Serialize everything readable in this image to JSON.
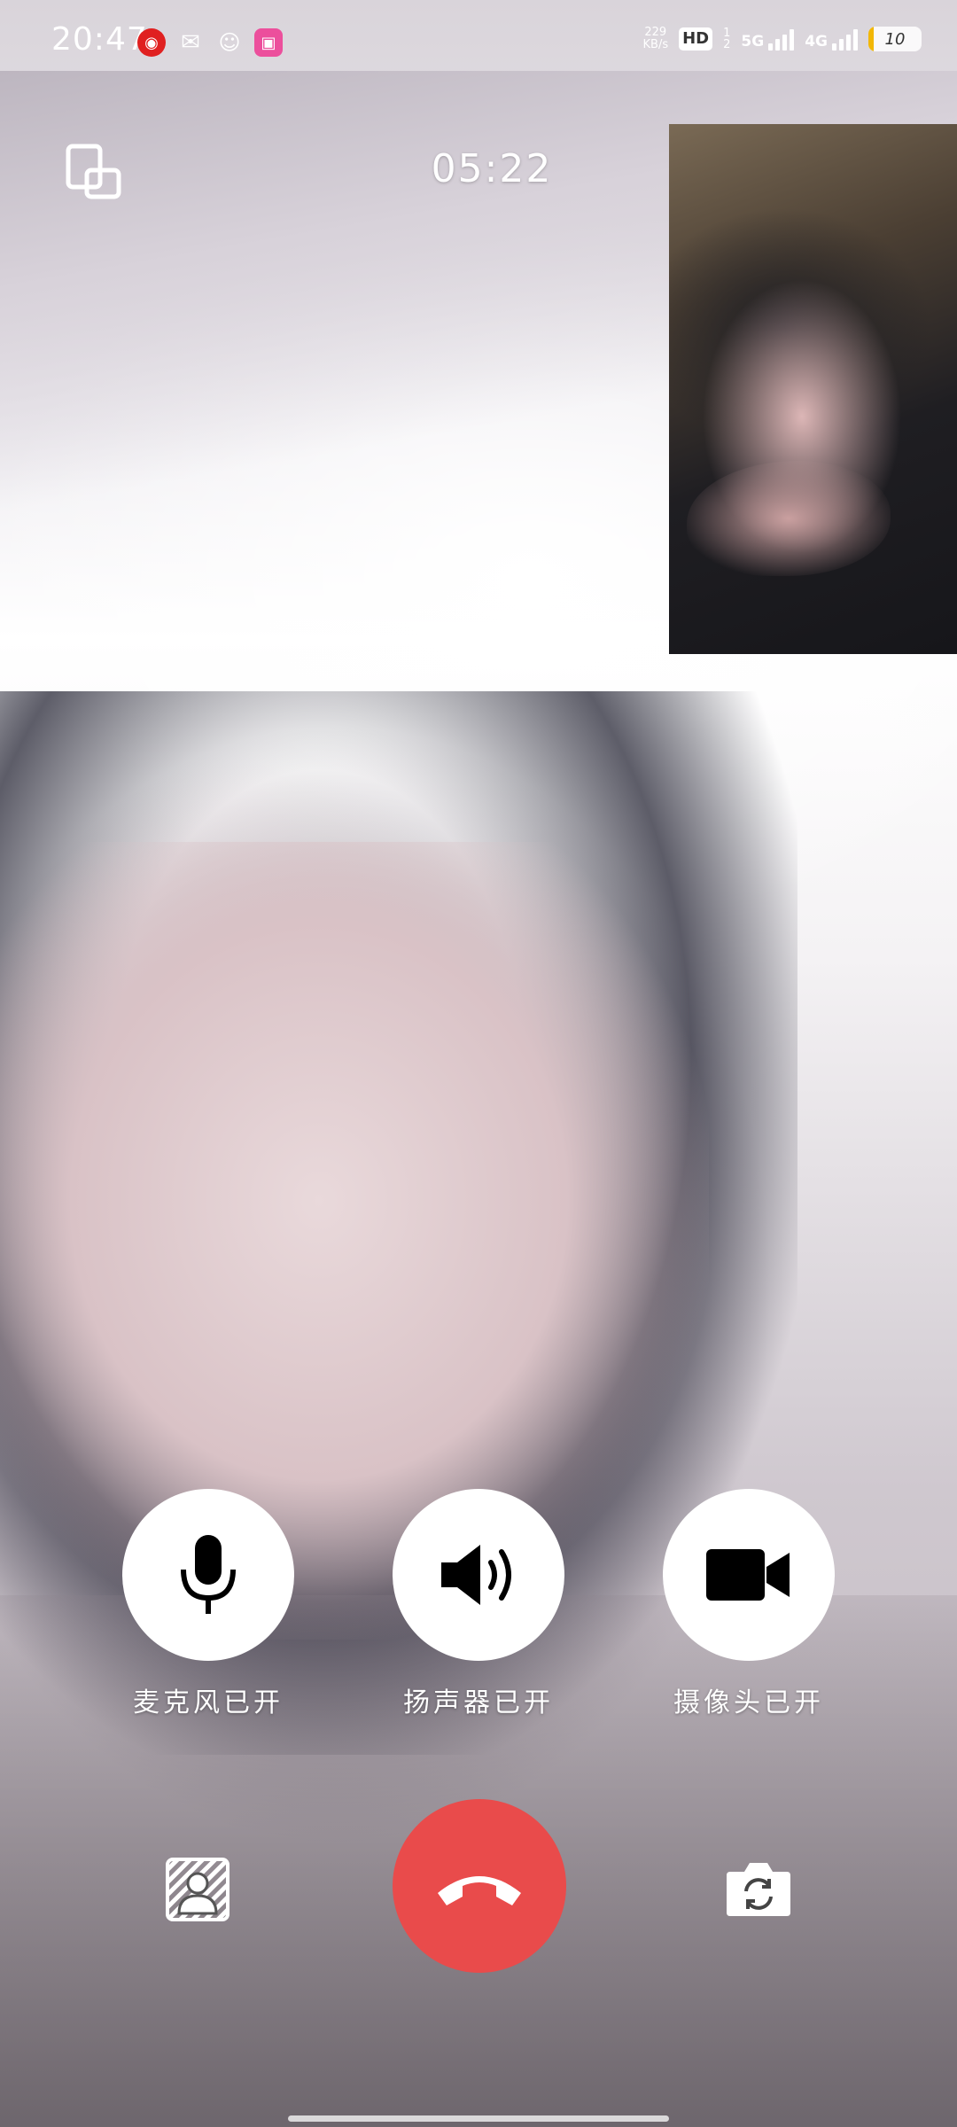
{
  "status_bar": {
    "time": "20:47",
    "apps": [
      "netease-music-icon",
      "wechat-icon",
      "cat-app-icon",
      "bilibili-icon"
    ],
    "net_speed_value": "229",
    "net_speed_unit": "KB/s",
    "hd_label": "HD",
    "sim1_label": "1",
    "sim2_label": "2",
    "gen1": "5G",
    "gen2": "4G",
    "battery_level": "10",
    "battery_fraction": 0.1
  },
  "call": {
    "timer": "05:22"
  },
  "controls": {
    "mic_label": "麦克风已开",
    "speaker_label": "扬声器已开",
    "camera_label": "摄像头已开"
  },
  "colors": {
    "hangup": "#e94b4b",
    "button_bg": "#ffffff",
    "battery_fill": "#f2b705"
  }
}
